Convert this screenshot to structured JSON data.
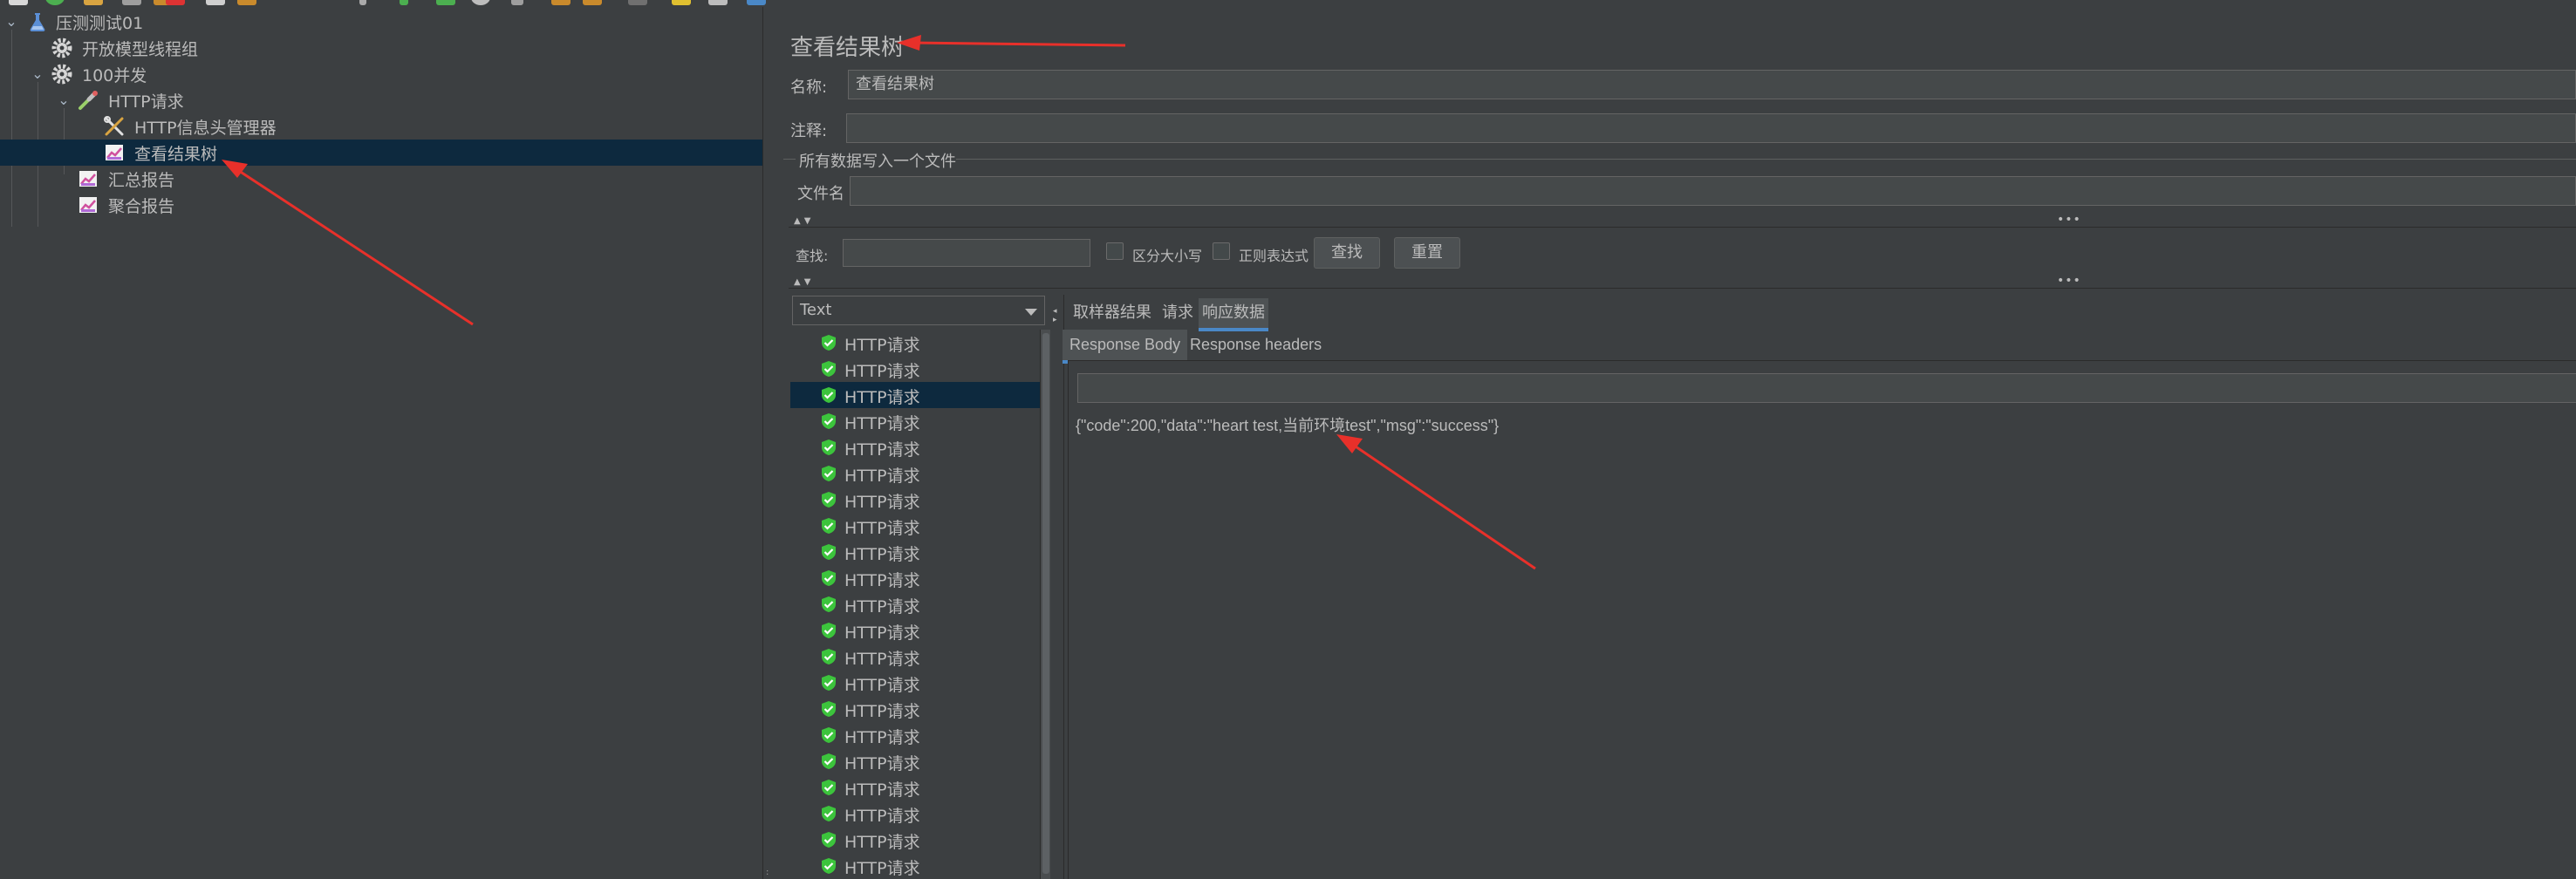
{
  "tree": {
    "items": [
      {
        "label": "压测测试01",
        "icon": "flask-icon",
        "level": 0,
        "expanded": true
      },
      {
        "label": "开放模型线程组",
        "icon": "gear-icon",
        "level": 1,
        "expanded": false
      },
      {
        "label": "100并发",
        "icon": "gear-icon",
        "level": 1,
        "expanded": true
      },
      {
        "label": "HTTP请求",
        "icon": "pipette-icon",
        "level": 2,
        "expanded": true
      },
      {
        "label": "HTTP信息头管理器",
        "icon": "tools-icon",
        "level": 3
      },
      {
        "label": "查看结果树",
        "icon": "chart-icon",
        "level": 3,
        "selected": true
      },
      {
        "label": "汇总报告",
        "icon": "chart-icon",
        "level": 2
      },
      {
        "label": "聚合报告",
        "icon": "chart-icon",
        "level": 2
      }
    ]
  },
  "panel": {
    "title": "查看结果树",
    "name_label": "名称:",
    "name_value": "查看结果树",
    "comment_label": "注释:",
    "comment_value": "",
    "file_section_title": "所有数据写入一个文件",
    "file_label": "文件名",
    "file_value": ""
  },
  "search": {
    "label": "查找:",
    "value": "",
    "case_sensitive_label": "区分大小写",
    "case_sensitive_checked": false,
    "regex_label": "正则表达式",
    "regex_checked": false,
    "find_button": "查找",
    "reset_button": "重置"
  },
  "results": {
    "renderer": "Text",
    "rows": [
      "HTTP请求",
      "HTTP请求",
      "HTTP请求",
      "HTTP请求",
      "HTTP请求",
      "HTTP请求",
      "HTTP请求",
      "HTTP请求",
      "HTTP请求",
      "HTTP请求",
      "HTTP请求",
      "HTTP请求",
      "HTTP请求",
      "HTTP请求",
      "HTTP请求",
      "HTTP请求",
      "HTTP请求",
      "HTTP请求",
      "HTTP请求",
      "HTTP请求",
      "HTTP请求"
    ],
    "selected_index": 2
  },
  "tabs": {
    "items": [
      "取样器结果",
      "请求",
      "响应数据"
    ],
    "active": 2
  },
  "subtabs": {
    "items": [
      "Response Body",
      "Response headers"
    ],
    "active": 0
  },
  "response": {
    "body": "{\"code\":200,\"data\":\"heart test,当前环境test\",\"msg\":\"success\"}"
  },
  "colors": {
    "background": "#3c3f41",
    "selection": "#0d293e",
    "text": "#bbbbbb",
    "tab_accent": "#4a88c7",
    "success_icon": "#3cc43c",
    "annotation_arrow": "#e8302a"
  }
}
